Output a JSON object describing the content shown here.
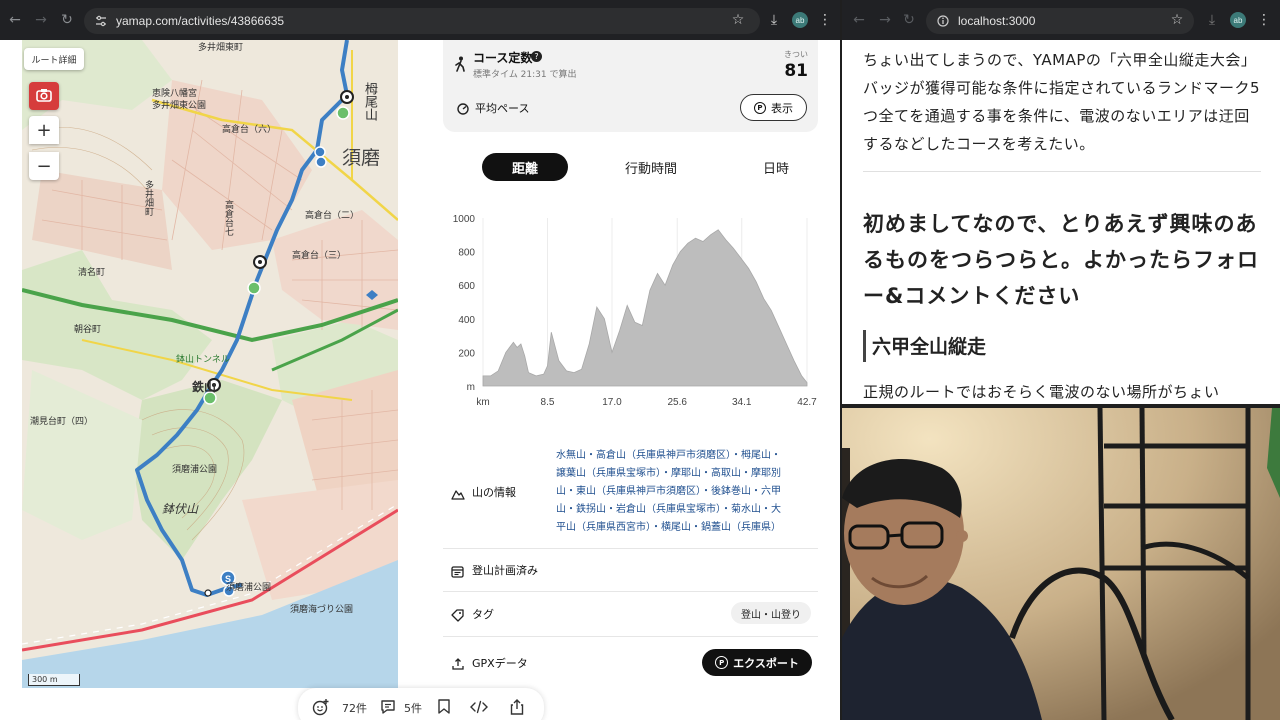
{
  "left_browser": {
    "url": "yamap.com/activities/43866635"
  },
  "map": {
    "route_detail_label": "ルート詳細",
    "zoom_in": "+",
    "zoom_out": "−",
    "scale_label": "300 m",
    "labels": {
      "tai": "多井畑東町",
      "kuboi": "恵険八幡宮",
      "higashi": "多井畑東公園",
      "takakura6": "高倉台（六）",
      "shimizugaoka": "清名町",
      "kumanocho": "多井畑町",
      "takakura3": "高倉台（三）",
      "takakura2": "高倉台（二）",
      "takakura7": "高倉台七",
      "asahi": "朝谷町",
      "hachiyama": "鉢山トンネル",
      "tessan": "鉄山",
      "kanbe": "須磨浦公園",
      "hachibuse": "鉢伏山",
      "sumaura": "須磨浦公園",
      "sumaumi": "須磨海づり公園",
      "shiohashi": "潮見台町（四）",
      "suma": "須磨",
      "kouyama": "栂尾山"
    }
  },
  "course_card": {
    "title": "コース定数",
    "subtitle": "標準タイム 21:31 で算出",
    "intensity_label": "きつい",
    "value": "81",
    "avg_pace_label": "平均ペース",
    "show_button": "表示"
  },
  "tabs": {
    "distance": "距離",
    "moving_time": "行動時間",
    "datetime": "日時"
  },
  "chart_data": {
    "type": "area",
    "title": "",
    "xlabel": "km",
    "ylabel": "m",
    "x_ticks": [
      "km",
      "8.5",
      "17.0",
      "25.6",
      "34.1",
      "42.7"
    ],
    "y_ticks": [
      "m",
      "200",
      "400",
      "600",
      "800",
      "1000"
    ],
    "ylim": [
      0,
      1000
    ],
    "xlim": [
      0,
      42.7
    ],
    "x": [
      0,
      1,
      2,
      3,
      4,
      4.5,
      5,
      5.5,
      6,
      7,
      8,
      8.5,
      9,
      10,
      11,
      12,
      13,
      14,
      15,
      16,
      16.5,
      17,
      18,
      19,
      20,
      21,
      22,
      23,
      24,
      25,
      26,
      27,
      28,
      29,
      30,
      31,
      32,
      33,
      34,
      35,
      36,
      37,
      38,
      39,
      40,
      41,
      42,
      42.7
    ],
    "y": [
      60,
      60,
      90,
      200,
      260,
      230,
      250,
      180,
      80,
      60,
      70,
      120,
      320,
      150,
      90,
      80,
      100,
      250,
      470,
      400,
      300,
      200,
      330,
      480,
      380,
      360,
      570,
      670,
      600,
      720,
      800,
      850,
      880,
      860,
      900,
      930,
      870,
      820,
      760,
      700,
      620,
      520,
      450,
      350,
      250,
      150,
      60,
      20
    ]
  },
  "mountain_info": {
    "label": "山の情報",
    "lines": [
      "水無山・高倉山（兵庫県神戸市須磨区）・栂尾山・",
      "譲葉山（兵庫県宝塚市）・摩耶山・高取山・摩耶別",
      "山・東山（兵庫県神戸市須磨区）・後鉢巻山・六甲",
      "山・鉄拐山・岩倉山（兵庫県宝塚市）・菊水山・大",
      "平山（兵庫県西宮市）・横尾山・鍋蓋山（兵庫県）"
    ]
  },
  "plan": {
    "label": "登山計画済み"
  },
  "tags": {
    "label": "タグ",
    "value": "登山・山登り"
  },
  "gpx": {
    "label": "GPXデータ",
    "export_button": "エクスポート"
  },
  "bottom_bar": {
    "likes": "72件",
    "comments": "5件"
  },
  "right_browser": {
    "url": "localhost:3000"
  },
  "article": {
    "intro": "ちょい出てしまうので、YAMAPの「六甲全山縦走大会」バッジが獲得可能な条件に指定されているランドマーク5つ全てを通過する事を条件に、電波のないエリアは迂回するなどしたコースを考えたい。",
    "heading": "初めましてなので、とりあえず興味のあるものをつらつらと。よかったらフォロー&コメントください",
    "subheading": "六甲全山縦走",
    "body": "正規のルートではおそらく電波のない場所がちょい"
  },
  "colors": {
    "route": "#3d7fc4",
    "chart_fill": "#bdbdbd",
    "heading_bar": "#444444",
    "link": "#1f4f8f"
  }
}
